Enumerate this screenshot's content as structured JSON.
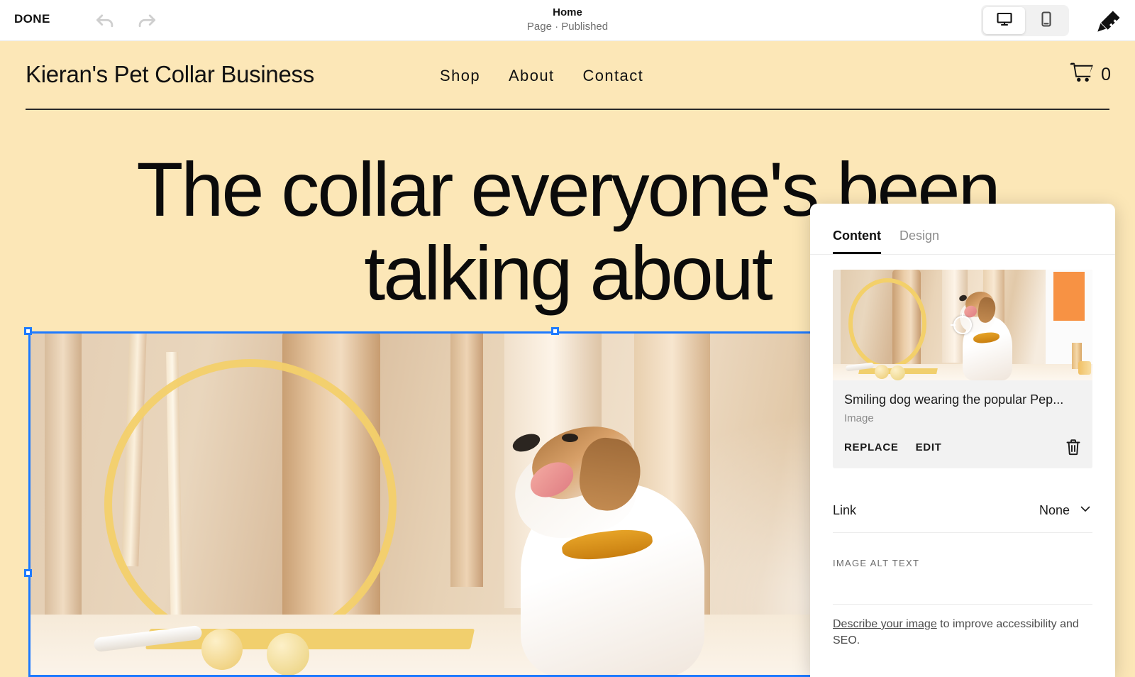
{
  "editor": {
    "done_label": "DONE",
    "undo_icon": "undo-arrow-icon",
    "redo_icon": "redo-arrow-icon",
    "page_title": "Home",
    "page_status": "Page · Published",
    "device_toggle": {
      "desktop_icon": "desktop-monitor-icon",
      "mobile_icon": "mobile-phone-icon",
      "selected": "desktop"
    },
    "brush_icon": "paintbrush-icon"
  },
  "site": {
    "brand": "Kieran's Pet Collar Business",
    "nav": [
      {
        "label": "Shop"
      },
      {
        "label": "About"
      },
      {
        "label": "Contact"
      }
    ],
    "cart": {
      "icon": "shopping-cart-icon",
      "count": "0"
    },
    "hero_heading": "The collar everyone's been\ntalking about",
    "background_color": "#fce7b7",
    "heading_color": "#0b0b0b"
  },
  "selection": {
    "accent_color": "#1d7aff",
    "handles": [
      "top-left",
      "top-center",
      "left-middle"
    ]
  },
  "panel": {
    "tabs": [
      {
        "label": "Content",
        "active": true
      },
      {
        "label": "Design",
        "active": false
      }
    ],
    "media": {
      "thumbnail_alt": "smiling-dog-wearing-collar-thumbnail",
      "focal_point_icon": "focal-point-crosshair-icon",
      "title": "Smiling dog wearing the popular Pep...",
      "subtype": "Image",
      "replace_label": "REPLACE",
      "edit_label": "EDIT",
      "delete_icon": "trash-icon"
    },
    "link_row": {
      "label": "Link",
      "value": "None",
      "chevron_icon": "chevron-down-icon"
    },
    "alt_text": {
      "label": "IMAGE ALT TEXT",
      "value": "",
      "placeholder": "",
      "help_link": "Describe your image",
      "help_rest": " to improve accessibility and SEO."
    }
  }
}
